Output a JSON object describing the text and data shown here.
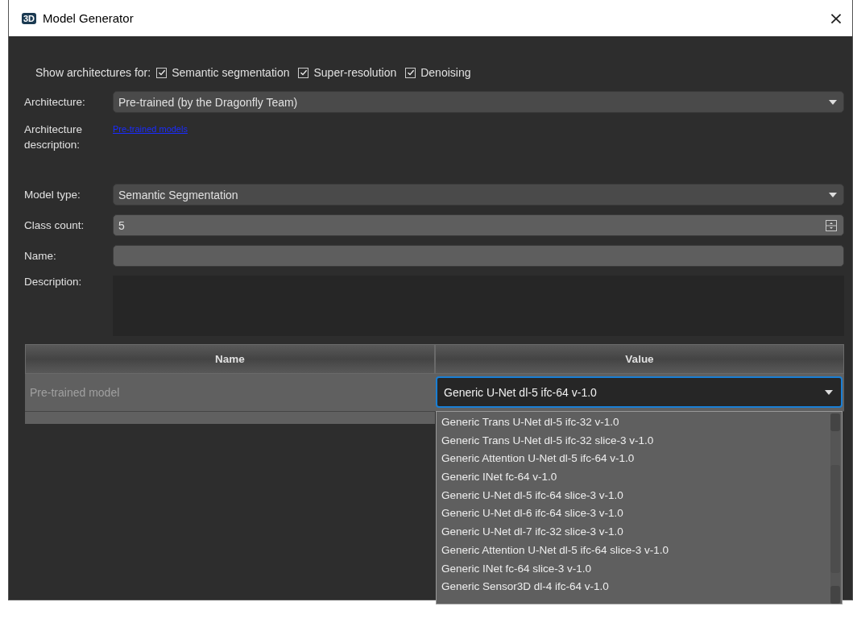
{
  "window": {
    "icon_text": "3D",
    "title": "Model Generator",
    "close": "×"
  },
  "filters": {
    "label": "Show architectures for:",
    "options": [
      {
        "label": "Semantic segmentation",
        "checked": true
      },
      {
        "label": "Super-resolution",
        "checked": true
      },
      {
        "label": "Denoising",
        "checked": true
      }
    ]
  },
  "architecture": {
    "label": "Architecture:",
    "value": "Pre-trained (by the Dragonfly Team)"
  },
  "architecture_description": {
    "label": "Architecture description:",
    "link": "Pre-trained models"
  },
  "model_type": {
    "label": "Model type:",
    "value": "Semantic Segmentation"
  },
  "class_count": {
    "label": "Class count:",
    "value": "5"
  },
  "name": {
    "label": "Name:"
  },
  "description": {
    "label": "Description:"
  },
  "table": {
    "columns": [
      "Name",
      "Value"
    ],
    "rows": [
      {
        "name": "Pre-trained model",
        "disabled": true,
        "value": "Generic U-Net dl-5 ifc-64 v-1.0"
      }
    ]
  },
  "dropdown": {
    "items": [
      "Generic Trans U-Net dl-5 ifc-32 v-1.0",
      "Generic Trans U-Net dl-5 ifc-32 slice-3 v-1.0",
      "Generic Attention U-Net dl-5 ifc-64 v-1.0",
      "Generic INet fc-64 v-1.0",
      "Generic U-Net dl-5 ifc-64 slice-3 v-1.0",
      "Generic U-Net dl-6 ifc-64 slice-3 v-1.0",
      "Generic U-Net dl-7 ifc-32 slice-3 v-1.0",
      "Generic Attention U-Net dl-5 ifc-64 slice-3 v-1.0",
      "Generic INet fc-64 slice-3 v-1.0",
      "Generic Sensor3D dl-4 ifc-64 v-1.0"
    ]
  }
}
